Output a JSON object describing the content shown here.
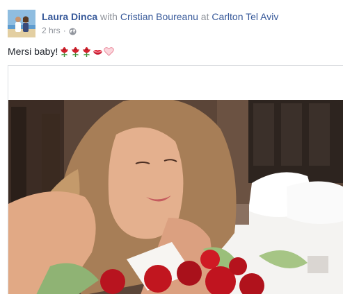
{
  "post": {
    "author": "Laura Dinca",
    "with_text": "with",
    "tagged": "Cristian Boureanu",
    "at_text": "at",
    "location": "Carlton Tel Aviv",
    "time": "2 hrs",
    "separator": "·",
    "privacy_icon": "globe-icon",
    "text": "Mersi baby!",
    "emojis": [
      "rose-icon",
      "rose-icon",
      "rose-icon",
      "kiss-mark-icon",
      "pink-heart-icon"
    ]
  },
  "colors": {
    "link": "#365899",
    "secondary_text": "#90949c",
    "body_text": "#1d2129",
    "border": "#dddfe2"
  }
}
